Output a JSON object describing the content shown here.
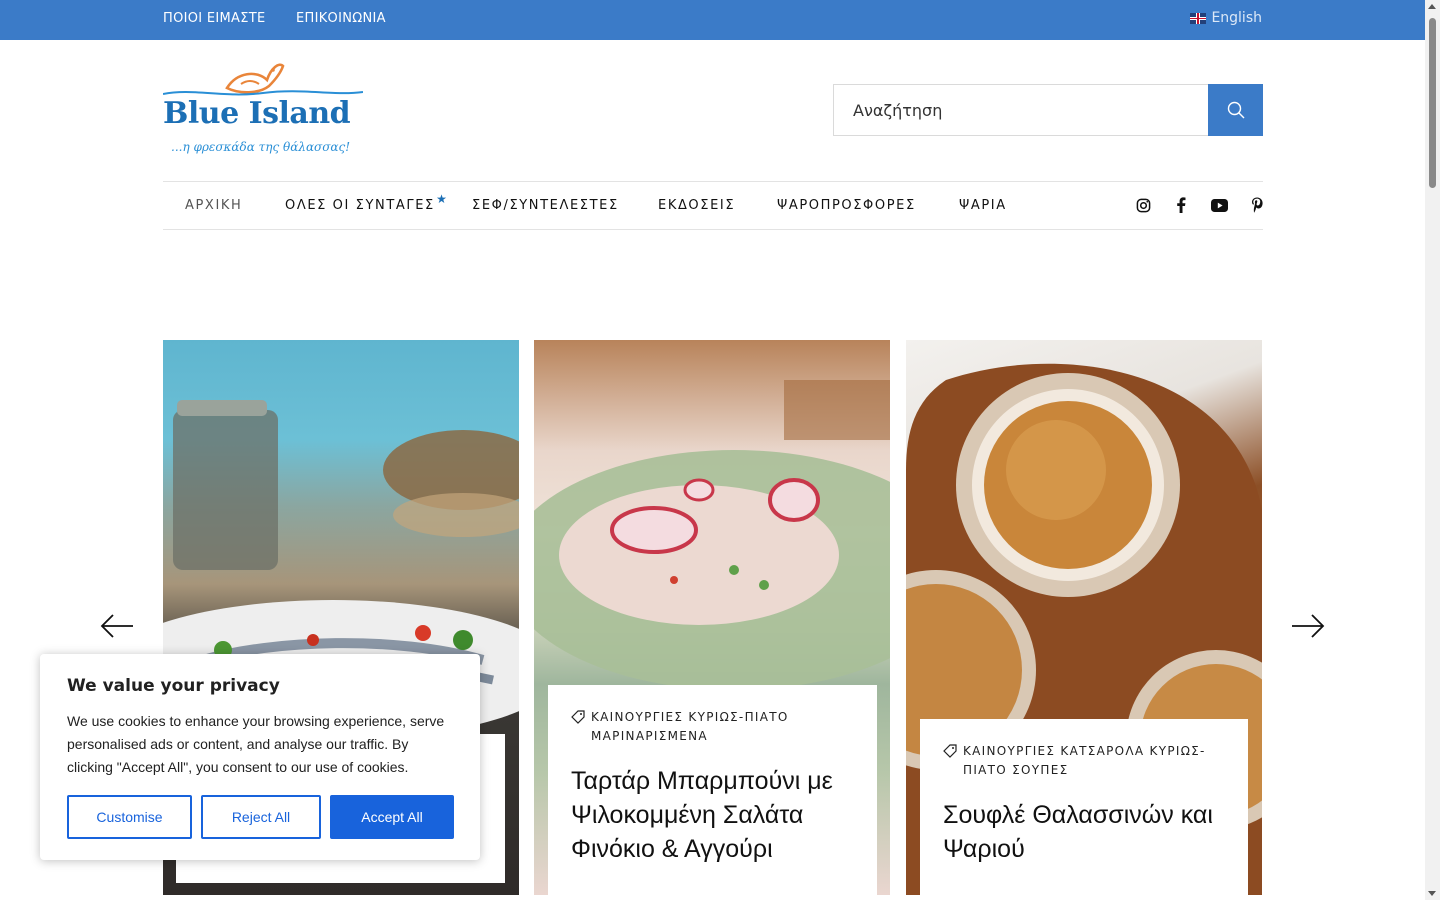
{
  "topbar": {
    "links": [
      "ΠΟΙΟΙ ΕΙΜΑΣΤΕ",
      "ΕΠΙΚΟΙΝΩΝΙΑ"
    ],
    "language": "English",
    "language_icon": "uk-flag-icon"
  },
  "logo": {
    "name": "Blue Island",
    "tagline": "...η φρεσκάδα της θάλασσας!"
  },
  "search": {
    "placeholder": "Αναζήτηση",
    "button_icon": "search-icon"
  },
  "nav": {
    "items": [
      {
        "label": "ΑΡΧΙΚΗ",
        "active": true
      },
      {
        "label": "ΟΛΕΣ ΟΙ ΣΥΝΤΑΓΕΣ",
        "badge": "★"
      },
      {
        "label": "ΣΕΦ/ΣΥΝΤΕΛΕΣΤΕΣ"
      },
      {
        "label": "ΕΚΔΟΣΕΙΣ"
      },
      {
        "label": "ΨΑΡΟΠΡΟΣΦΟΡΕΣ"
      },
      {
        "label": "ΨΑΡΙΑ"
      }
    ],
    "social_icons": [
      "instagram-icon",
      "facebook-icon",
      "youtube-icon",
      "pinterest-icon"
    ]
  },
  "carousel": {
    "prev_icon": "arrow-left-icon",
    "next_icon": "arrow-right-icon",
    "cards": [
      {
        "image": "anchovies-plate-photo",
        "tags": "",
        "title": ""
      },
      {
        "image": "red-mullet-tartare-photo",
        "tags": "ΚΑΙΝΟΥΡΓΙΕΣ ΚΥΡΙΩΣ-ΠΙΑΤΟ ΜΑΡΙΝΑΡΙΣΜΕΝΑ",
        "title": "Ταρτάρ Μπαρμπούνι με Ψιλοκομμένη Σαλάτα Φινόκιο & Αγγούρι"
      },
      {
        "image": "seafood-souffle-photo",
        "tags": "ΚΑΙΝΟΥΡΓΙΕΣ ΚΑΤΣΑΡΟΛΑ ΚΥΡΙΩΣ-ΠΙΑΤΟ ΣΟΥΠΕΣ",
        "title": "Σουφλέ Θαλασσινών και Ψαριού"
      }
    ]
  },
  "cookie": {
    "title": "We value your privacy",
    "text": "We use cookies to enhance your browsing experience, serve personalised ads or content, and analyse our traffic. By clicking \"Accept All\", you consent to our use of cookies.",
    "buttons": {
      "customise": "Customise",
      "reject": "Reject All",
      "accept": "Accept All"
    },
    "accent": "#1863dc"
  },
  "colors": {
    "brand_blue": "#3b7bc8",
    "logo_blue": "#1c6fb5",
    "logo_orange": "#e9853a"
  }
}
